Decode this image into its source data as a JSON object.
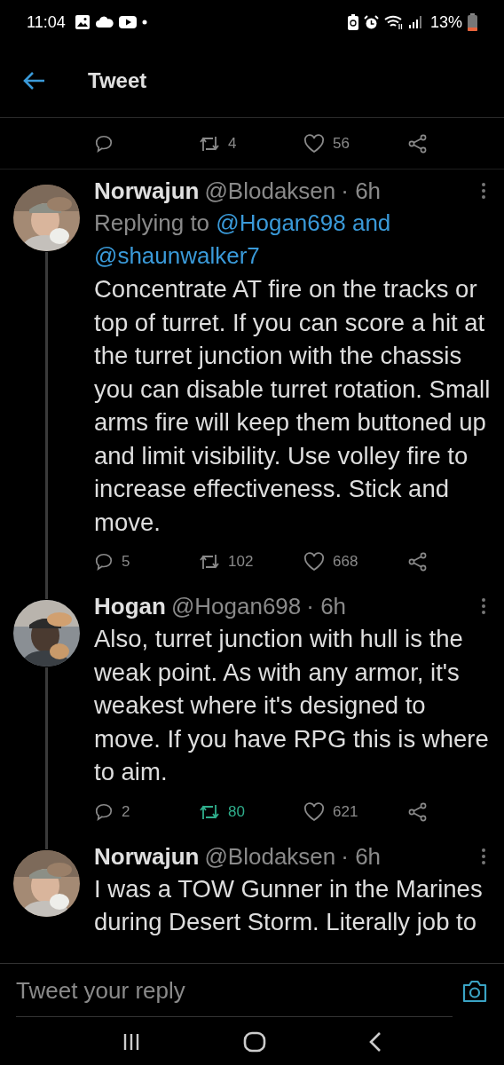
{
  "status_bar": {
    "time": "11:04",
    "battery": "13%"
  },
  "header": {
    "title": "Tweet"
  },
  "main_actions": {
    "retweets": "4",
    "likes": "56",
    "retweeted": false,
    "liked": false
  },
  "tweets": [
    {
      "name": "Norwajun",
      "handle": "@Blodaksen",
      "time": "· 6h",
      "replying": {
        "label": "Replying to",
        "mentions": [
          "@Hogan698",
          "@shaunwalker7"
        ],
        "joiner": "and"
      },
      "text": "Concentrate AT fire on the tracks or top of turret. If you can score a hit at the turret junction with the chassis you can disable turret rotation. Small arms fire will keep them buttoned up and limit visibility. Use volley fire to increase effectiveness. Stick and move.",
      "replies": "5",
      "retweets": "102",
      "likes": "668",
      "retweeted": false,
      "liked": false,
      "thread_line": true
    },
    {
      "name": "Hogan",
      "handle": "@Hogan698",
      "time": "· 6h",
      "text": "Also, turret junction with hull is the weak point. As with any armor, it's weakest where it's designed to move. If you have RPG this is where to aim.",
      "replies": "2",
      "retweets": "80",
      "likes": "621",
      "retweeted": true,
      "liked": false,
      "thread_line": true
    },
    {
      "name": "Norwajun",
      "handle": "@Blodaksen",
      "time": "· 6h",
      "text": "I was a TOW Gunner in the Marines during Desert Storm. Literally job to",
      "thread_line": false
    }
  ],
  "reply_bar": {
    "placeholder": "Tweet your reply"
  }
}
